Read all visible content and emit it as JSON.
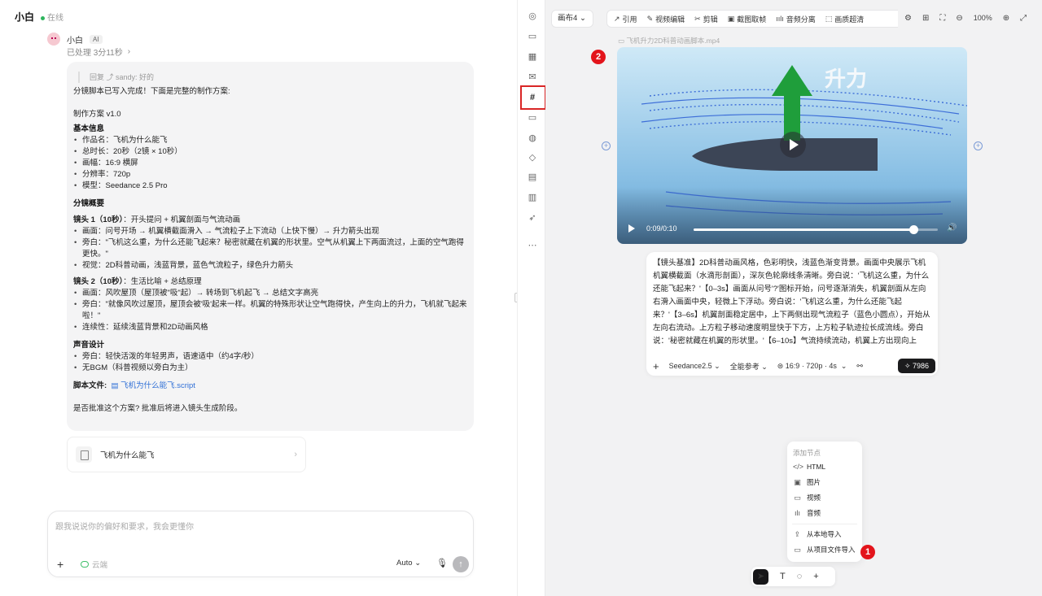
{
  "chat": {
    "title": "小白",
    "status": "在线",
    "bot_name": "小白",
    "ai_badge": "AI",
    "processed": "已处理 3分11秒",
    "quote": "回复 ⤴ sandy:  好的",
    "intro": "分镜脚本已写入完成！下面是完整的制作方案:",
    "plan_version": "制作方案 v1.0",
    "basic_info_title": "基本信息",
    "basic_info": [
      "作品名：飞机为什么能飞",
      "总时长：20秒（2镜 × 10秒）",
      "画幅：16:9 横屏",
      "分辨率：720p",
      "模型：Seedance 2.5 Pro"
    ],
    "overview_title": "分镜概要",
    "shot1_title": "镜头 1（10秒）",
    "shot1_sub": "：开头提问 + 机翼剖面与气流动画",
    "shot1_items": [
      "画面：问号开场 → 机翼横截面滑入 → 气流粒子上下流动（上快下慢）→ 升力箭头出现",
      "旁白：\"飞机这么重，为什么还能飞起来？秘密就藏在机翼的形状里。空气从机翼上下两面流过，上面的空气跑得更快。\"",
      "视觉：2D科普动画，浅蓝背景，蓝色气流粒子，绿色升力箭头"
    ],
    "shot2_title": "镜头 2（10秒）",
    "shot2_sub": "：生活比喻 + 总结原理",
    "shot2_items": [
      "画面：风吹屋顶（屋顶被\"吸\"起）→ 转场到飞机起飞 → 总结文字高亮",
      "旁白：\"就像风吹过屋顶，屋顶会被'吸'起来一样。机翼的特殊形状让空气跑得快，产生向上的升力，飞机就飞起来啦！\"",
      "连续性：延续浅蓝背景和2D动画风格"
    ],
    "audio_title": "声音设计",
    "audio_items": [
      "旁白：轻快活泼的年轻男声，语速适中（约4字/秒）",
      "无BGM（科普视频以旁白为主）"
    ],
    "script_label": "脚本文件:",
    "script_file": "飞机为什么能飞.script",
    "approval": "是否批准这个方案? 批准后将进入镜头生成阶段。",
    "file_card_name": "飞机为什么能飞",
    "composer_placeholder": "跟我说说你的偏好和要求，我会更懂你",
    "composer_cloud": "云端",
    "composer_mode": "Auto"
  },
  "rail": {
    "icons": [
      "compass-icon",
      "folder-icon",
      "calendar-icon",
      "mail-icon",
      "hash-icon",
      "monitor-icon",
      "fingerprint-icon",
      "cube-icon",
      "clapper-icon",
      "film-icon",
      "rocket-icon",
      "more-icon"
    ]
  },
  "canvas": {
    "name_select": "画布4",
    "toolbar": [
      "引用",
      "视频编辑",
      "剪辑",
      "截图取帧",
      "音频分离",
      "画质超清"
    ],
    "zoom": "100%",
    "video_title": "飞机升力2D科普动画脚本.mp4",
    "video_overlay_text": "升力",
    "video_time": "0:09/0:10",
    "video_progress": 0.9,
    "marker_2": "2",
    "marker_1": "1",
    "prompt_text": "【镜头基准】2D科普动画风格，色彩明快，浅蓝色渐变背景。画面中央展示飞机机翼横截面（水滴形剖面），深灰色轮廓线条清晰。旁白说：'飞机这么重，为什么还能飞起来？'【0–3s】画面从问号'?'图标开始，问号逐渐消失，机翼剖面从左向右滑入画面中央，轻微上下浮动。旁白说：'飞机这么重，为什么还能飞起来？'【3–6s】机翼剖面稳定居中，上下两侧出现气流粒子（蓝色小圆点），开始从左向右流动。上方粒子移动速度明显快于下方，上方粒子轨迹拉长成流线。旁白说：'秘密就藏在机翼的形状里。'【6–10s】气流持续流动，机翼上方出现向上",
    "prompt_model": "Seedance2.5",
    "prompt_ref": "全能参考",
    "prompt_spec": "16:9 · 720p · 4s",
    "credits": "7986",
    "node_menu_title": "添加节点",
    "node_items": [
      "HTML",
      "图片",
      "视频",
      "音频"
    ],
    "import_items": [
      "从本地导入",
      "从项目文件导入"
    ]
  },
  "colors": {
    "accent_red": "#d92626",
    "status_green": "#2db55d",
    "link_blue": "#2f6fd6"
  }
}
